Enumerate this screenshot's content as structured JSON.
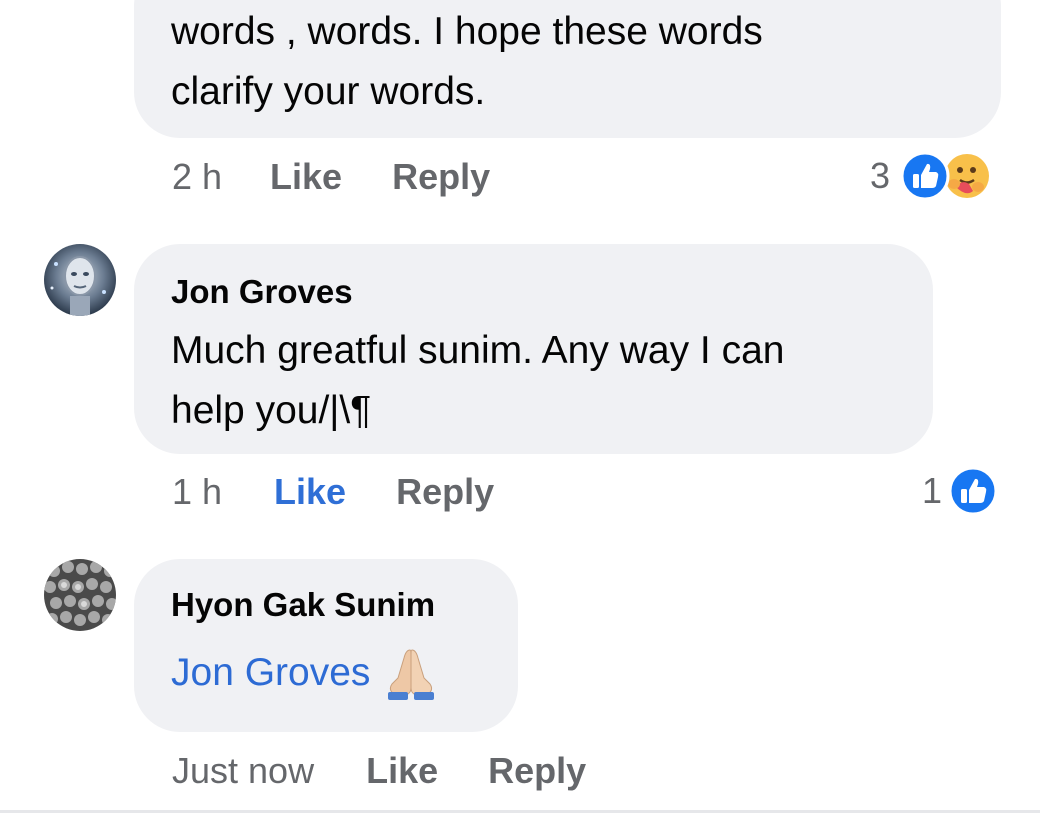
{
  "comments": [
    {
      "text_line1": "words , words. I hope these words",
      "text_line2": "clarify your words.",
      "time": "2 h",
      "like": "Like",
      "reply": "Reply",
      "reaction_count": "3",
      "reaction_icons": [
        "like-icon",
        "care-icon"
      ]
    },
    {
      "author": "Jon Groves",
      "text_line1": "Much greatful sunim. Any way I can",
      "text_line2": "help you/|\\¶",
      "time": "1 h",
      "like": "Like",
      "reply": "Reply",
      "reaction_count": "1",
      "reaction_icons": [
        "like-icon"
      ],
      "liked_by_viewer": true
    },
    {
      "author": "Hyon Gak Sunim",
      "mention": "Jon Groves",
      "emoji": "folded-hands-emoji",
      "time": "Just now",
      "like": "Like",
      "reply": "Reply"
    }
  ],
  "colors": {
    "bubble": "#f0f1f4",
    "link_blue": "#2d6bd4",
    "meta_gray": "#65676b",
    "like_blue": "#1877f2"
  }
}
